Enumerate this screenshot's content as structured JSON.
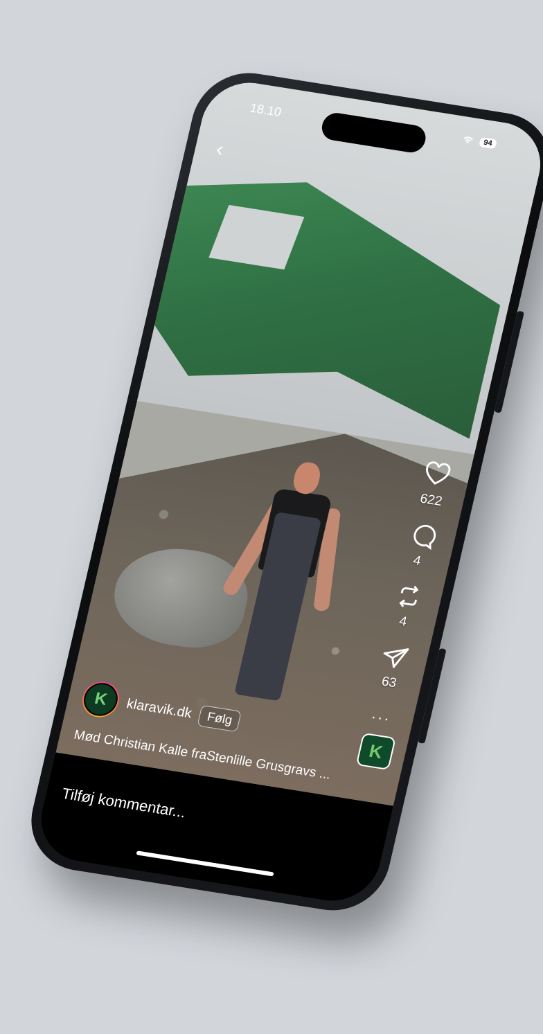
{
  "status_bar": {
    "time": "18.10",
    "battery": "94"
  },
  "post": {
    "likes": "622",
    "comments": "4",
    "reposts": "4",
    "shares": "63",
    "author": "klaravik.dk",
    "follow_label": "Følg",
    "avatar_letter": "K",
    "caption": "Mød Christian Kalle fraStenlille Grusgravs ...",
    "music_letter": "K"
  },
  "comment": {
    "placeholder": "Tilføj kommentar..."
  },
  "icons": {
    "back": "chevron-left-icon",
    "like": "heart-icon",
    "comment": "speech-bubble-icon",
    "repost": "repost-icon",
    "share": "send-icon",
    "more": "more-icon"
  }
}
